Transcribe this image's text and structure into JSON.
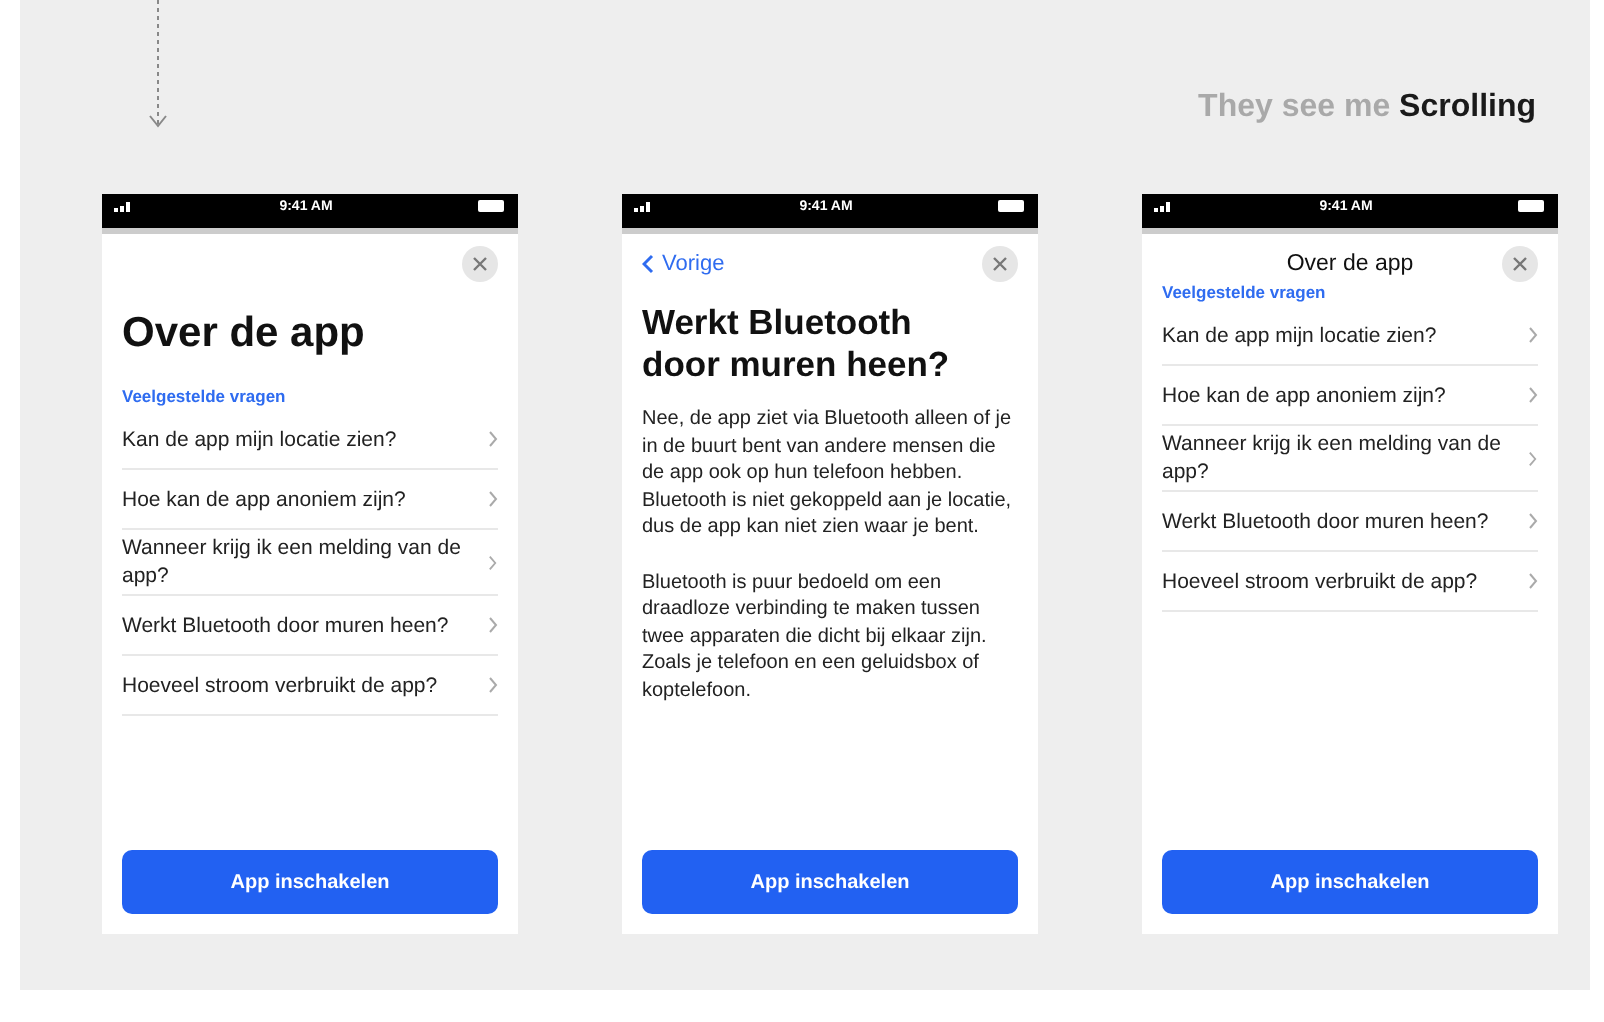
{
  "caption": "They see me **Scrolling**",
  "phones": [
    {
      "kind": "home",
      "time": "9:41 AM",
      "title": "Over de app",
      "section": "Veelgestelde vragen",
      "items": [
        "Kan de app mijn locatie zien?",
        "Hoe kan de app anoniem zijn?",
        "Wanneer krijg ik een melding van de app?",
        "Werkt Bluetooth door muren heen?",
        "Hoeveel stroom verbruikt de app?"
      ],
      "button": "App inschakelen"
    },
    {
      "kind": "detail",
      "time": "9:41 AM",
      "back": "Vorige",
      "title": "Werkt Bluetooth door muren heen?",
      "paragraphs": [
        "Nee, de app ziet via Bluetooth alleen of je in de buurt bent van andere mensen die de app ook op hun telefoon hebben. Bluetooth is niet gekoppeld aan je locatie, dus de app kan niet zien waar je bent.",
        "Bluetooth is puur bedoeld om een draadloze verbinding te maken tussen twee apparaten die dicht bij elkaar zijn. Zoals je telefoon en een geluidsbox of koptelefoon."
      ],
      "button": "App inschakelen"
    },
    {
      "kind": "scrolled",
      "time": "9:41 AM",
      "title": "Over de app",
      "section": "Veelgestelde vragen",
      "items": [
        "Kan de app mijn locatie zien?",
        "Hoe kan de app anoniem zijn?",
        "Wanneer krijg ik een melding van de app?",
        "Werkt Bluetooth door muren heen?",
        "Hoeveel stroom verbruikt de app?"
      ],
      "button": "App inschakelen"
    }
  ]
}
